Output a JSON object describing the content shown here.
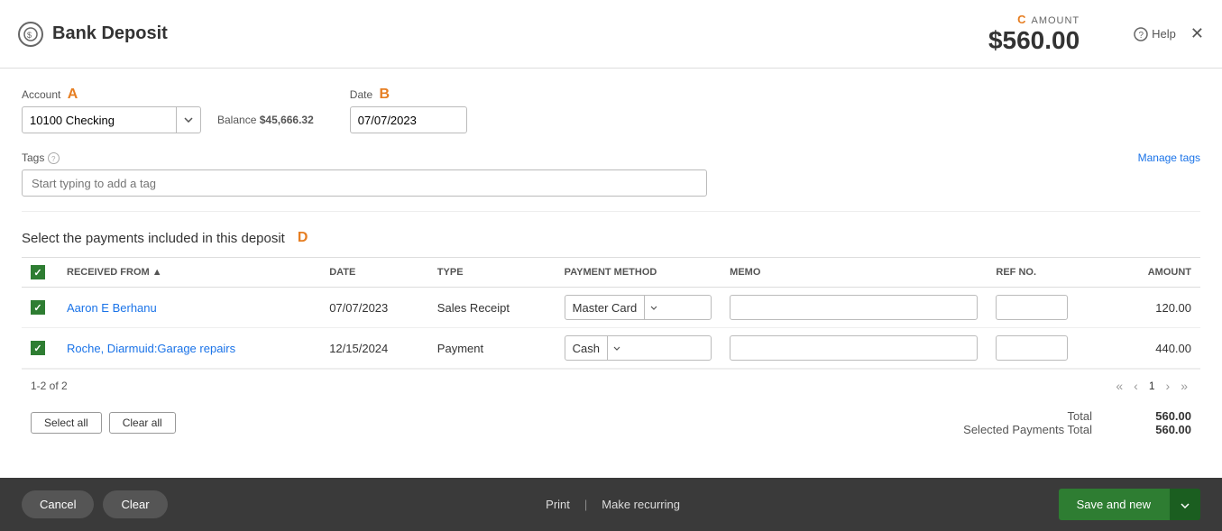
{
  "header": {
    "title": "Bank Deposit",
    "help_label": "Help",
    "amount_label": "AMOUNT",
    "amount_value": "$560.00"
  },
  "form": {
    "account_label": "Account",
    "account_step": "A",
    "account_value": "10100 Checking",
    "balance_label": "Balance",
    "balance_value": "$45,666.32",
    "date_label": "Date",
    "date_step": "B",
    "date_value": "07/07/2023",
    "amount_step": "C"
  },
  "tags": {
    "label": "Tags",
    "placeholder": "Start typing to add a tag",
    "manage_link": "Manage tags"
  },
  "payments": {
    "title": "Select the payments included in this deposit",
    "step": "D",
    "columns": {
      "received_from": "RECEIVED FROM ▲",
      "date": "DATE",
      "type": "TYPE",
      "payment_method": "PAYMENT METHOD",
      "memo": "MEMO",
      "ref_no": "REF NO.",
      "amount": "AMOUNT"
    },
    "rows": [
      {
        "checked": true,
        "received_from": "Aaron E Berhanu",
        "date": "07/07/2023",
        "type": "Sales Receipt",
        "payment_method": "Master Card",
        "memo": "",
        "ref_no": "",
        "amount": "120.00"
      },
      {
        "checked": true,
        "received_from": "Roche, Diarmuid:Garage repairs",
        "date": "12/15/2024",
        "type": "Payment",
        "payment_method": "Cash",
        "memo": "",
        "ref_no": "",
        "amount": "440.00"
      }
    ],
    "pagination_info": "1-2 of 2",
    "pagination_page": "1",
    "select_all_btn": "Select all",
    "clear_all_btn": "Clear all",
    "total_label": "Total",
    "total_value": "560.00",
    "selected_total_label": "Selected Payments Total",
    "selected_total_value": "560.00"
  },
  "footer": {
    "cancel_btn": "Cancel",
    "clear_btn": "Clear",
    "print_link": "Print",
    "make_recurring_link": "Make recurring",
    "save_new_btn": "Save and new"
  }
}
